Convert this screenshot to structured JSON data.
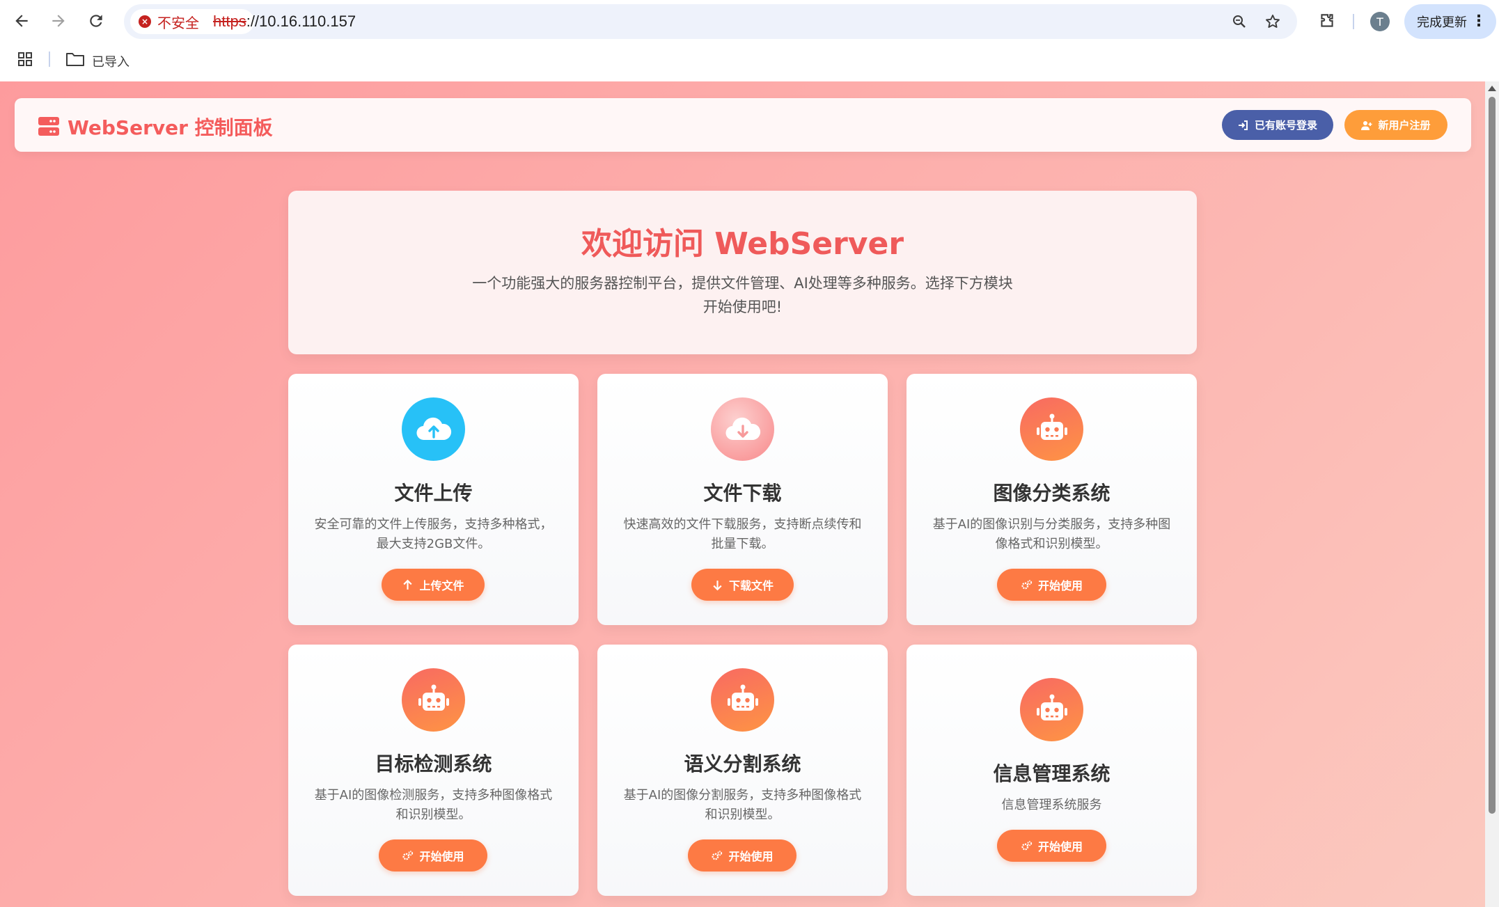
{
  "browser": {
    "security_label": "不安全",
    "url_scheme": "https",
    "url_rest": "://10.16.110.157",
    "avatar_letter": "T",
    "update_label": "完成更新",
    "bookmark_folder": "已导入"
  },
  "header": {
    "brand": "WebServer 控制面板",
    "login_label": "已有账号登录",
    "register_label": "新用户注册"
  },
  "hero": {
    "title": "欢迎访问 WebServer",
    "subtitle": "一个功能强大的服务器控制平台，提供文件管理、AI处理等多种服务。选择下方模块开始使用吧!"
  },
  "cards": [
    {
      "title": "文件上传",
      "desc": "安全可靠的文件上传服务，支持多种格式，最大支持2GB文件。",
      "button": "上传文件",
      "icon": "cloud-upload-icon"
    },
    {
      "title": "文件下载",
      "desc": "快速高效的文件下载服务，支持断点续传和批量下载。",
      "button": "下载文件",
      "icon": "cloud-download-icon"
    },
    {
      "title": "图像分类系统",
      "desc": "基于AI的图像识别与分类服务，支持多种图像格式和识别模型。",
      "button": "开始使用",
      "icon": "robot-icon"
    },
    {
      "title": "目标检测系统",
      "desc": "基于AI的图像检测服务，支持多种图像格式和识别模型。",
      "button": "开始使用",
      "icon": "robot-icon"
    },
    {
      "title": "语义分割系统",
      "desc": "基于AI的图像分割服务，支持多种图像格式和识别模型。",
      "button": "开始使用",
      "icon": "robot-icon"
    },
    {
      "title": "信息管理系统",
      "desc": "信息管理系统服务",
      "button": "开始使用",
      "icon": "robot-icon"
    }
  ],
  "colors": {
    "brand_red": "#f45c5c",
    "login_blue": "#4a5fa8",
    "register_orange": "#fe9d3a",
    "card_button_orange": "#fd7a44",
    "upload_blue": "#27c1f7"
  }
}
